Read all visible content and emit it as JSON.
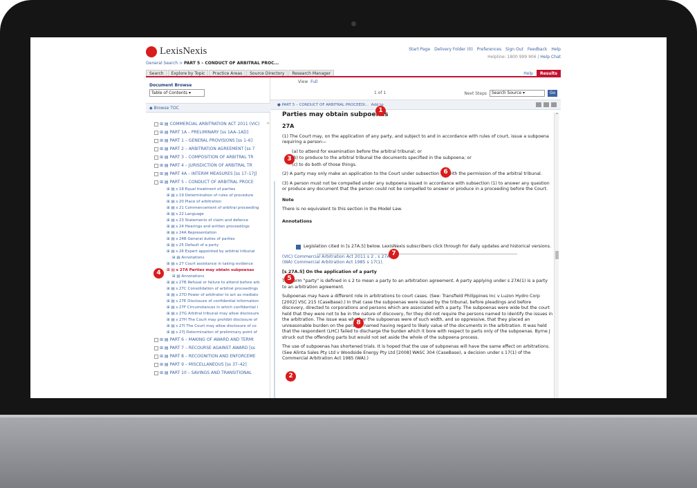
{
  "app": {
    "brand": "LexisNexis",
    "brand_color": "#d91c1c",
    "accent": "#c41230",
    "link_color": "#3b62a4"
  },
  "breadcrumb": {
    "root": "General Search",
    "sep": " > ",
    "current": "PART 5 – CONDUCT OF ARBITRAL PROC..."
  },
  "utility": {
    "links": [
      "Start Page",
      "Delivery Folder (0)",
      "Preferences",
      "Sign Out",
      "Feedback",
      "Help"
    ],
    "helpline": "Helpline: 1800 999 906",
    "help_chat": "Help Chat"
  },
  "tabs": [
    "Search",
    "Explore by Topic",
    "Practice Areas",
    "Source Directory",
    "Research Manager"
  ],
  "tabs_right": {
    "help": "Help",
    "results": "Results"
  },
  "left": {
    "doc_browse": "Document Browse",
    "toc_select": "Table of Contents",
    "browse_toc": "Browse TOC",
    "tree": [
      {
        "label": "COMMERCIAL ARBITRATION ACT 2011 (VIC)",
        "level": 0
      },
      {
        "label": "PART 1A – PRELIMINARY [ss 1AA–1AD]",
        "level": 0
      },
      {
        "label": "PART 1 – GENERAL PROVISIONS [ss 1–6]",
        "level": 0
      },
      {
        "label": "PART 2 – ARBITRATION AGREEMENT [ss 7",
        "level": 0
      },
      {
        "label": "PART 3 – COMPOSITION OF ARBITRAL TR",
        "level": 0
      },
      {
        "label": "PART 4 – JURISDICTION OF ARBITRAL TR",
        "level": 0
      },
      {
        "label": "PART 4A – INTERIM MEASURES [ss 17–17J]",
        "level": 0
      },
      {
        "label": "PART 5 – CONDUCT OF ARBITRAL PROCE",
        "level": 0
      },
      {
        "label": "s 18 Equal treatment of parties",
        "level": 1
      },
      {
        "label": "s 19 Determination of rules of procedure",
        "level": 1
      },
      {
        "label": "s 20 Place of arbitration",
        "level": 1
      },
      {
        "label": "s 21 Commencement of arbitral proceeding",
        "level": 1
      },
      {
        "label": "s 22 Language",
        "level": 1
      },
      {
        "label": "s 23 Statements of claim and defence",
        "level": 1
      },
      {
        "label": "s 24 Hearings and written proceedings",
        "level": 1
      },
      {
        "label": "s 24A Representation",
        "level": 1
      },
      {
        "label": "s 24B General duties of parties",
        "level": 1
      },
      {
        "label": "s 25 Default of a party",
        "level": 1
      },
      {
        "label": "s 26 Expert appointed by arbitral tribunal",
        "level": 1
      },
      {
        "label": "Annotations",
        "level": 2
      },
      {
        "label": "s 27 Court assistance in taking evidence",
        "level": 1
      },
      {
        "label": "s 27A Parties may obtain subpoenas",
        "level": 1,
        "active": true
      },
      {
        "label": "Annotations",
        "level": 2
      },
      {
        "label": "s 27B Refusal or failure to attend before arb",
        "level": 1
      },
      {
        "label": "s 27C Consolidation of arbitral proceedings",
        "level": 1
      },
      {
        "label": "s 27D Power of arbitrator to act as mediato",
        "level": 1
      },
      {
        "label": "s 27E Disclosure of confidential information",
        "level": 1
      },
      {
        "label": "s 27F Circumstances in which confidential i",
        "level": 1
      },
      {
        "label": "s 27G Arbitral tribunal may allow disclosure",
        "level": 1
      },
      {
        "label": "s 27H The Court may prohibit disclosure of",
        "level": 1
      },
      {
        "label": "s 27I The Court may allow disclosure of co",
        "level": 1
      },
      {
        "label": "s 27J Determination of preliminary point of",
        "level": 1
      },
      {
        "label": "PART 6 – MAKING OF AWARD AND TERMI",
        "level": 0
      },
      {
        "label": "PART 7 – RECOURSE AGAINST AWARD [ss",
        "level": 0
      },
      {
        "label": "PART 8 – RECOGNITION AND ENFORCEME",
        "level": 0
      },
      {
        "label": "PART 9 – MISCELLANEOUS [ss 37–42]",
        "level": 0
      },
      {
        "label": "PART 10 – SAVINGS AND TRANSITIONAL",
        "level": 0
      }
    ]
  },
  "viewbar": {
    "view": "View",
    "full": "Full",
    "pager": "1 of 1",
    "next_steps": "Next Steps",
    "source": "Search Source",
    "go": "Go"
  },
  "docbar": {
    "title": "PART 5 – CONDUCT OF ARBITRAL PROCEEDI...",
    "add_to": "Add to"
  },
  "doc": {
    "heading": "Parties may obtain subpoenas",
    "section": "27A",
    "p1": "(1) The Court may, on the application of any party, and subject to and in accordance with rules of court, issue a subpoena requiring a person—",
    "list": [
      "(a)  to attend for examination before the arbitral tribunal; or",
      "(b)  to produce to the arbitral tribunal the documents specified in the subpoena; or",
      "(c)  to do both of those things."
    ],
    "p2": "(2) A party may only make an application to the Court under subsection (1) with the permission of the arbitral tribunal.",
    "p3": "(3) A person must not be compelled under any subpoena issued in accordance with subsection (1) to answer any question or produce any document that the person could not be compelled to answer or produce in a proceeding before the Court.",
    "note_head": "Note",
    "note": "There is no equivalent to this section in the Model Law.",
    "ann_head": "Annotations",
    "legislation": "Legislation cited in [s 27A.5] below. LexisNexis subscribers click through for daily updates and historical versions.",
    "cite1": "(VIC) Commercial Arbitration Act 2011 s 2 , s 27A(1).",
    "cite2": "(WA) Commercial Arbitration Act 1985 s 17(1).",
    "sub_head": "[s 27A.5] On the application of a party",
    "p4": "The term \"party\" is defined in s 2 to mean a party to an arbitration agreement. A party applying under s 27A(1) is a party to an arbitration agreement.",
    "p5": "Subpoenas may have a different role in arbitrations to court cases. (See: Transfield Philippines Inc v Luzon Hydro Corp [2002] VSC 215 (CaseBase).) In that case the subpoenas were issued by the tribunal, before pleadings and before discovery, directed to corporations and persons which are associated with a party. The subpoenas were wide but the court held that they were not to be in the nature of discovery, for they did not require the persons named to identify the issues in the arbitration. The issue was whether the subpoenas were of such width, and so oppressive, that they placed an unreasonable burden on the persons named having regard to likely value of the documents in the arbitration. It was held that the respondent (LHC) failed to discharge the burden which it bore with respect to parts only of the subpoenas. Byrne J struck out the offending parts but would not set aside the whole of the subpoena process.",
    "p6": "The use of subpoenas has shortened trials. It is hoped that the use of subpoenas will have the same effect on arbitrations. (See Alinta Sales Pty Ltd v Woodside Energy Pty Ltd [2008] WASC 304 (CaseBase), a decision under s 17(1) of the Commercial Arbitration Act 1985 (WA).)"
  },
  "markers": [
    "1",
    "2",
    "3",
    "4",
    "5",
    "6",
    "7",
    "8"
  ]
}
